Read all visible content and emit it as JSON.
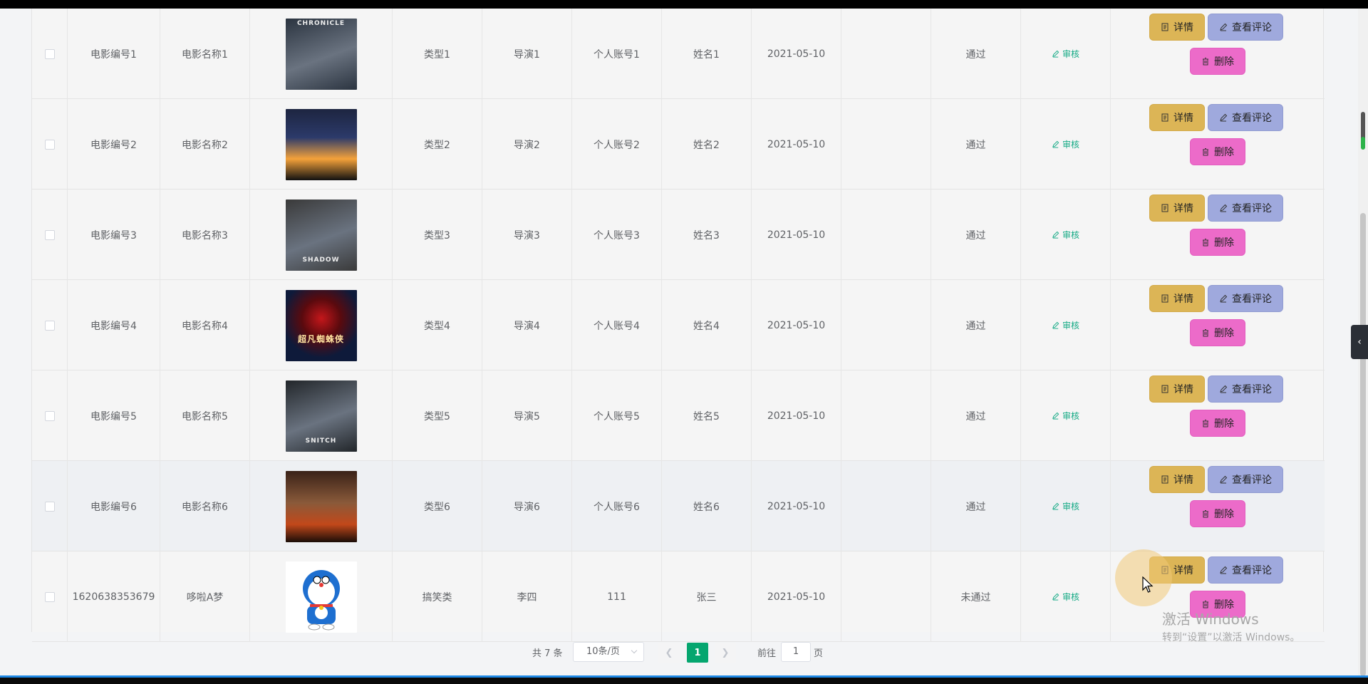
{
  "rows": [
    {
      "id": "电影编号1",
      "name": "电影名称1",
      "type": "类型1",
      "director": "导演1",
      "account": "个人账号1",
      "person": "姓名1",
      "date": "2021-05-10",
      "status": "通过",
      "poster_title": "CHRONICLE",
      "poster_bg": "#2b3440"
    },
    {
      "id": "电影编号2",
      "name": "电影名称2",
      "type": "类型2",
      "director": "导演2",
      "account": "个人账号2",
      "person": "姓名2",
      "date": "2021-05-10",
      "status": "通过",
      "poster_title": "",
      "poster_bg": "#1d2540"
    },
    {
      "id": "电影编号3",
      "name": "电影名称3",
      "type": "类型3",
      "director": "导演3",
      "account": "个人账号3",
      "person": "姓名3",
      "date": "2021-05-10",
      "status": "通过",
      "poster_title": "SHADOW",
      "poster_bg": "#3a3a3a"
    },
    {
      "id": "电影编号4",
      "name": "电影名称4",
      "type": "类型4",
      "director": "导演4",
      "account": "个人账号4",
      "person": "姓名4",
      "date": "2021-05-10",
      "status": "通过",
      "poster_title": "超凡蜘蛛侠",
      "poster_bg": "#0e1a3a"
    },
    {
      "id": "电影编号5",
      "name": "电影名称5",
      "type": "类型5",
      "director": "导演5",
      "account": "个人账号5",
      "person": "姓名5",
      "date": "2021-05-10",
      "status": "通过",
      "poster_title": "SNITCH",
      "poster_bg": "#22262a"
    },
    {
      "id": "电影编号6",
      "name": "电影名称6",
      "type": "类型6",
      "director": "导演6",
      "account": "个人账号6",
      "person": "姓名6",
      "date": "2021-05-10",
      "status": "通过",
      "poster_title": "",
      "poster_bg": "#3a2218"
    },
    {
      "id": "1620638353679",
      "name": "哆啦A梦",
      "type": "搞笑类",
      "director": "李四",
      "account": "111",
      "person": "张三",
      "date": "2021-05-10",
      "status": "未通过",
      "poster_title": "",
      "poster_bg": "#ffffff"
    }
  ],
  "labels": {
    "audit": "审核",
    "detail": "详情",
    "comment": "查看评论",
    "delete": "删除"
  },
  "pagination": {
    "total": "共 7 条",
    "page_size": "10条/页",
    "current_page": "1",
    "goto_prefix": "前往",
    "goto_value": "1",
    "goto_suffix": "页"
  },
  "watermark": {
    "line1": "激活 Windows",
    "line2": "转到“设置”以激活 Windows。"
  },
  "colors": {
    "detail": "#dcb556",
    "comment": "#9fa9dd",
    "delete": "#ec6bc9",
    "audit": "#13a984",
    "page_active": "#05a66f"
  }
}
